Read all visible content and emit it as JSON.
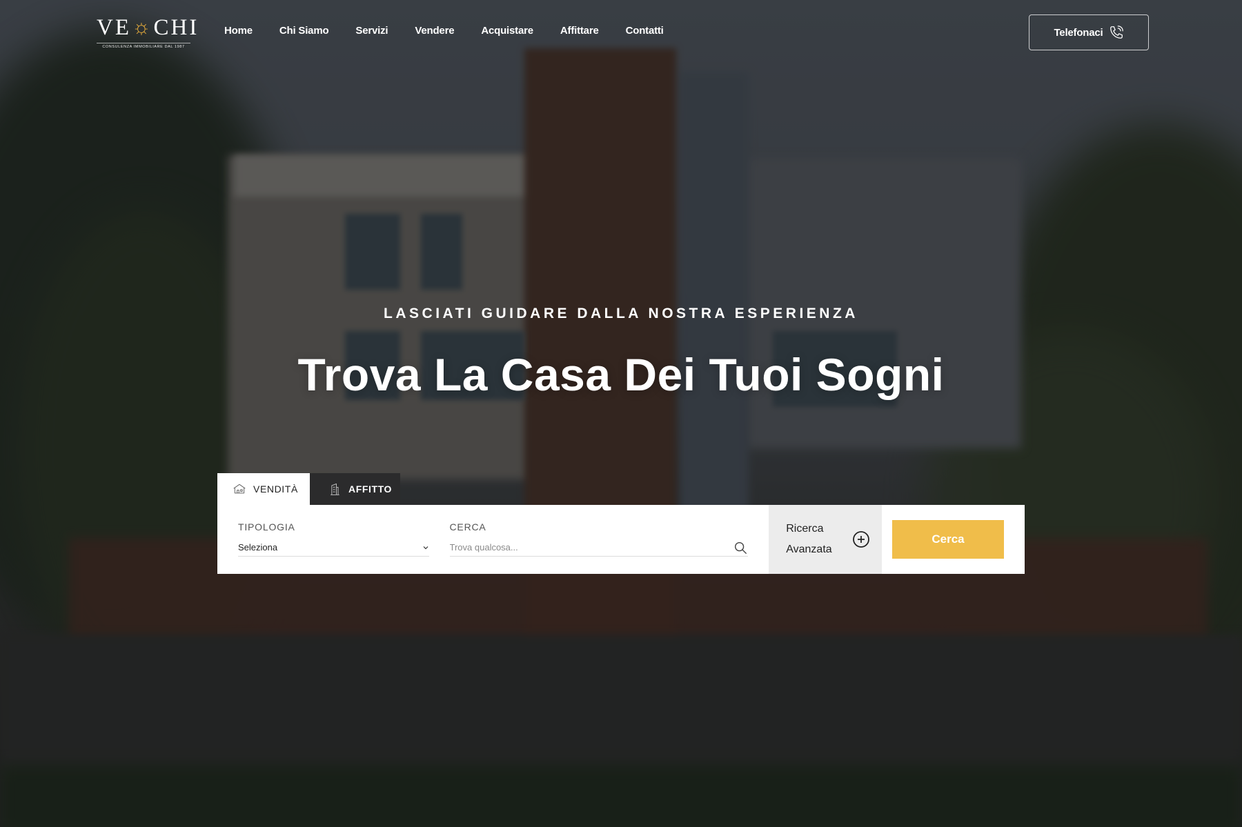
{
  "brand": {
    "name_left": "VE",
    "name_right": "CHI",
    "tagline": "CONSULENZA IMMOBILIARE DAL 1987"
  },
  "nav": {
    "items": [
      {
        "label": "Home"
      },
      {
        "label": "Chi Siamo"
      },
      {
        "label": "Servizi"
      },
      {
        "label": "Vendere"
      },
      {
        "label": "Acquistare"
      },
      {
        "label": "Affittare"
      },
      {
        "label": "Contatti"
      }
    ],
    "call_label": "Telefonaci"
  },
  "hero": {
    "eyebrow": "LASCIATI GUIDARE DALLA NOSTRA ESPERIENZA",
    "title": "Trova La Casa Dei Tuoi Sogni"
  },
  "search": {
    "tabs": [
      {
        "label": "VENDITÀ",
        "icon": "house-icon",
        "active": true
      },
      {
        "label": "AFFITTO",
        "icon": "building-icon",
        "active": false
      }
    ],
    "type_label": "TIPOLOGIA",
    "type_value": "Seleziona",
    "query_label": "CERCA",
    "query_placeholder": "Trova qualcosa...",
    "advanced_label": "Ricerca Avanzata",
    "submit_label": "Cerca"
  },
  "colors": {
    "accent": "#f0bd4a",
    "logo_sun": "#e2a93b",
    "tab_dark": "#2b2b2c"
  }
}
